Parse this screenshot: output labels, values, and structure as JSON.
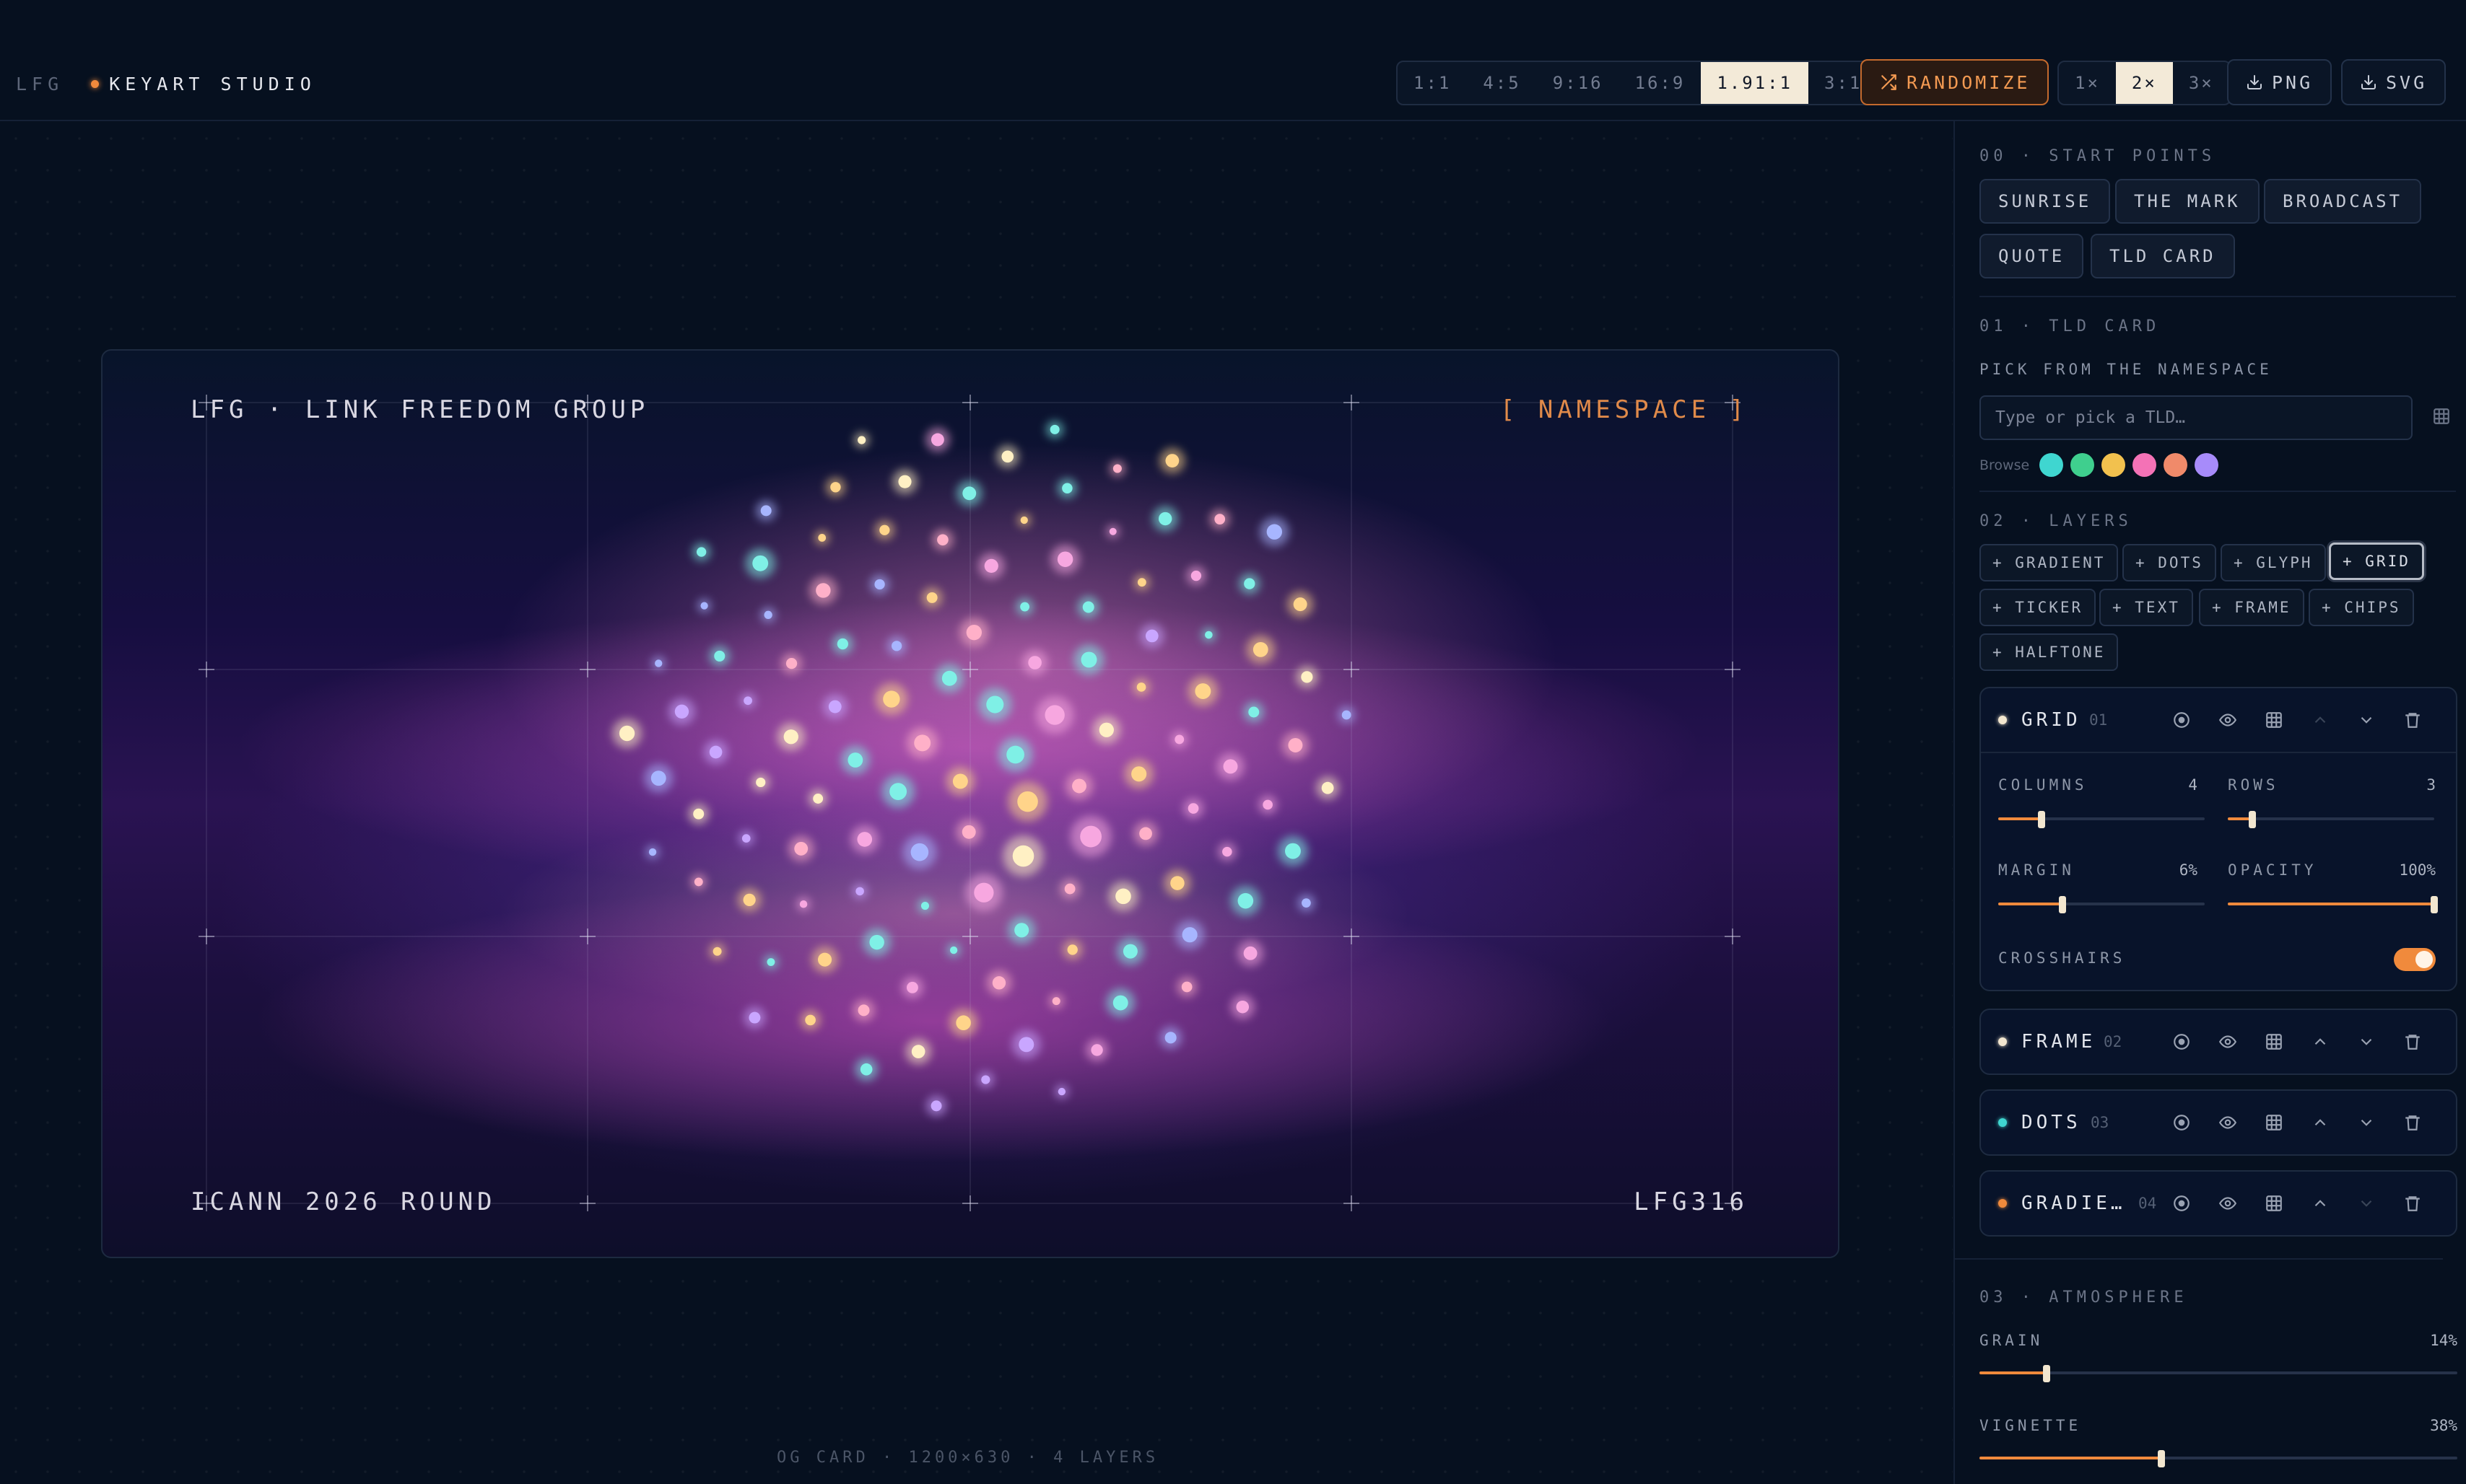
{
  "brand": {
    "lfg": "LFG",
    "studio": "KEYART STUDIO"
  },
  "toolbar": {
    "ratios": [
      "1:1",
      "4:5",
      "9:16",
      "16:9",
      "1.91:1",
      "3:1"
    ],
    "active_ratio": "1.91:1",
    "randomize": "RANDOMIZE",
    "scales": [
      "1×",
      "2×",
      "3×"
    ],
    "active_scale": "2×",
    "png": "PNG",
    "svg": "SVG"
  },
  "card": {
    "top_left": "LFG · LINK FREEDOM GROUP",
    "top_right": "[ NAMESPACE ]",
    "bottom_left": "ICANN 2026 ROUND",
    "bottom_right": "LFG316"
  },
  "footer": "OG CARD · 1200×630 · 4 LAYERS",
  "sidebar": {
    "start_points": {
      "title": "00 · START POINTS",
      "items": [
        "SUNRISE",
        "THE MARK",
        "BROADCAST",
        "QUOTE",
        "TLD CARD"
      ]
    },
    "tld_card": {
      "title": "01 · TLD CARD",
      "subtitle": "PICK FROM THE NAMESPACE",
      "placeholder": "Type or pick a TLD…",
      "browse_label": "Browse",
      "swatches": [
        "#3fd6d0",
        "#3fcf8e",
        "#f2c14e",
        "#f472b6",
        "#f08a6a",
        "#a78bfa"
      ]
    },
    "layers": {
      "title": "02 · LAYERS",
      "add_buttons": [
        "+ GRADIENT",
        "+ DOTS",
        "+ GLYPH",
        "+ GRID",
        "+ TICKER",
        "+ TEXT",
        "+ FRAME",
        "+ CHIPS",
        "+ HALFTONE"
      ],
      "selected_add": "+ GRID",
      "list": [
        {
          "name": "GRID",
          "num": "01",
          "dot": "#f2e6cf"
        },
        {
          "name": "FRAME",
          "num": "02",
          "dot": "#f2e6cf"
        },
        {
          "name": "DOTS",
          "num": "03",
          "dot": "#3fd6d0"
        },
        {
          "name": "GRADIE…",
          "num": "04",
          "dot": "#f08a3c"
        }
      ],
      "grid_params": {
        "columns_label": "COLUMNS",
        "columns": "4",
        "columns_fraction": 0.21,
        "rows_label": "ROWS",
        "rows": "3",
        "rows_fraction": 0.12,
        "margin_label": "MARGIN",
        "margin": "6%",
        "margin_fraction": 0.31,
        "opacity_label": "OPACITY",
        "opacity": "100%",
        "opacity_fraction": 1.0,
        "crosshairs_label": "CROSSHAIRS",
        "crosshairs": true
      }
    },
    "atmosphere": {
      "title": "03 · ATMOSPHERE",
      "grain_label": "GRAIN",
      "grain": "14%",
      "grain_fraction": 0.14,
      "vignette_label": "VIGNETTE",
      "vignette": "38%",
      "vignette_fraction": 0.38
    }
  }
}
